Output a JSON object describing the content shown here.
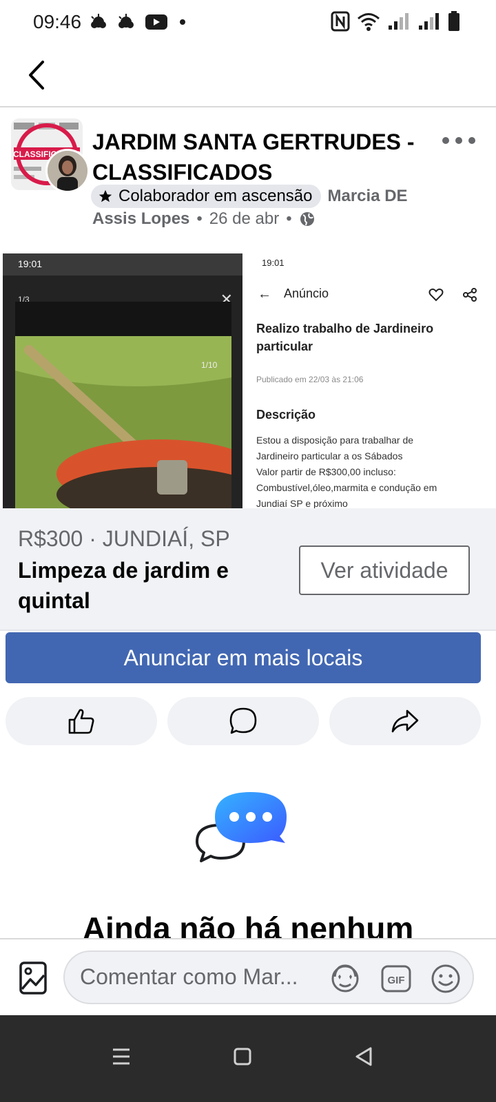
{
  "status_bar": {
    "time": "09:46",
    "icons": [
      "weather-cloud-icon",
      "weather-cloud-icon",
      "youtube-icon",
      "dot-icon",
      "nfc-icon",
      "wifi-icon",
      "signal-icon",
      "signal-icon",
      "battery-icon"
    ]
  },
  "post": {
    "group_name": "JARDIM SANTA GERTRUDES - CLASSIFICADOS",
    "badge_label": "Colaborador em ascensão",
    "author_name_part1": "Marcia DE",
    "author_name_part2": "Assis Lopes",
    "date": "26 de abr",
    "separator": "•",
    "group_avatar_text": "CLASSIFICADOS"
  },
  "embedded_screenshot": {
    "left": {
      "time": "19:01",
      "counter": "1/3",
      "photo_counter": "1/10",
      "close": "✕"
    },
    "right": {
      "time": "19:01",
      "header_title": "Anúncio",
      "ad_title": "Realizo trabalho de Jardineiro particular",
      "published": "Publicado em 22/03 às 21:06",
      "description_heading": "Descrição",
      "description_lines": [
        "Estou a disposição para trabalhar de",
        "Jardineiro particular a os Sábados",
        "Valor partir de R$300,00 incluso:",
        "Combustível,óleo,marmita e condução em",
        "Jundiaí SP e próximo"
      ]
    }
  },
  "listing": {
    "price_location": "R$300 · JUNDIAÍ, SP",
    "title": "Limpeza de jardim e quintal",
    "activity_button": "Ver atividade"
  },
  "promote_button": "Anunciar em mais locais",
  "actions": {
    "like": "like-icon",
    "comment": "comment-icon",
    "share": "share-icon"
  },
  "empty_state": {
    "text": "Ainda não há nenhum"
  },
  "comment_bar": {
    "placeholder": "Comentar como Mar...",
    "gif_label": "GIF"
  },
  "colors": {
    "primary_blue": "#4267b2",
    "secondary_text": "#65676b",
    "surface": "#f0f2f5",
    "messenger_blue": "#1877f2"
  }
}
